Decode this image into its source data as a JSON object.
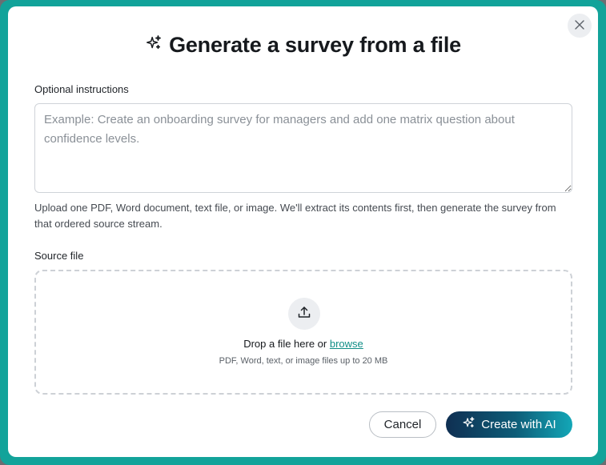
{
  "dialog": {
    "title": "Generate a survey from a file",
    "close_label": "Close"
  },
  "instructions": {
    "label": "Optional instructions",
    "value": "",
    "placeholder": "Example: Create an onboarding survey for managers and add one matrix question about confidence levels."
  },
  "help_text": "Upload one PDF, Word document, text file, or image. We'll extract its contents first, then generate the survey from that ordered source stream.",
  "source_file": {
    "label": "Source file",
    "drop_prefix": "Drop a file here or",
    "browse_link": "browse",
    "hint": "PDF, Word, text, or image files up to 20 MB"
  },
  "actions": {
    "cancel_label": "Cancel",
    "create_label": "Create with AI"
  },
  "colors": {
    "accent": "#12a39a",
    "link": "#0f8d86",
    "primary_gradient_start": "#0f2f52",
    "primary_gradient_end": "#13a7b7"
  },
  "icons": {
    "title": "sparkles-icon",
    "close": "close-icon",
    "upload": "upload-icon",
    "create": "sparkles-icon"
  }
}
